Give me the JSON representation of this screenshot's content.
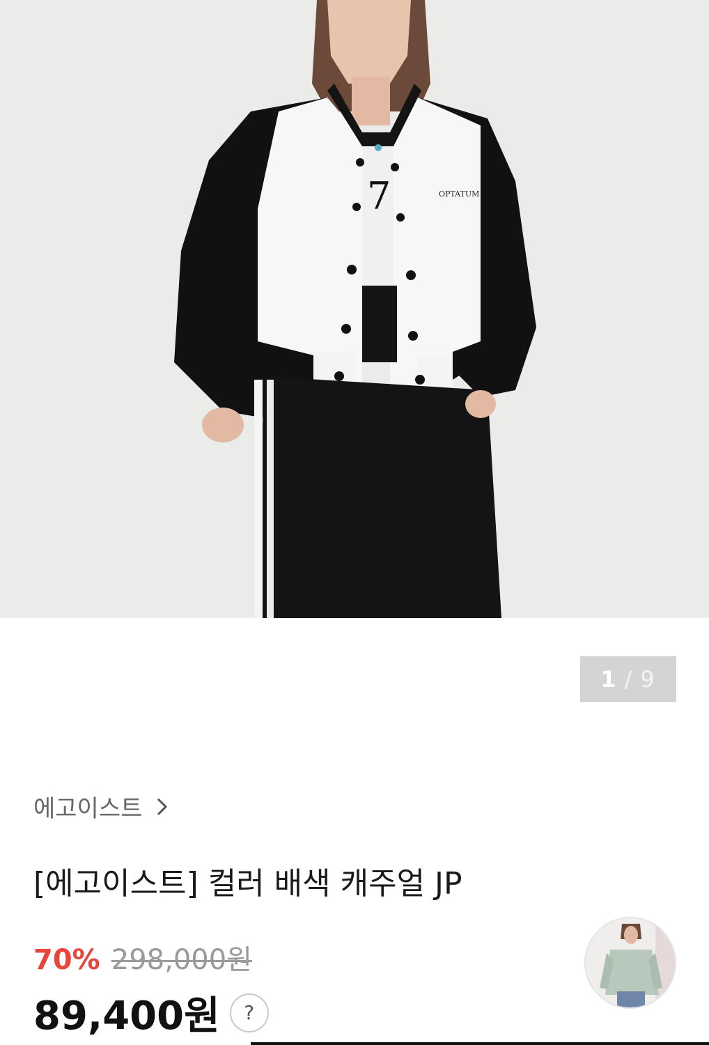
{
  "gallery": {
    "current": "1",
    "separator": "/",
    "total": "9"
  },
  "jacket_logo_text": "OPTATUM",
  "brand": {
    "name": "에고이스트",
    "icon": "chevron-right-icon"
  },
  "product": {
    "title": "[에고이스트] 컬러 배색 캐주얼 JP",
    "discount": "70%",
    "original_price": "298,000원",
    "price": "89,400원",
    "help_label": "?"
  },
  "colors": {
    "discount": "#e8463c",
    "counter_bg": "#d4d4d4"
  }
}
